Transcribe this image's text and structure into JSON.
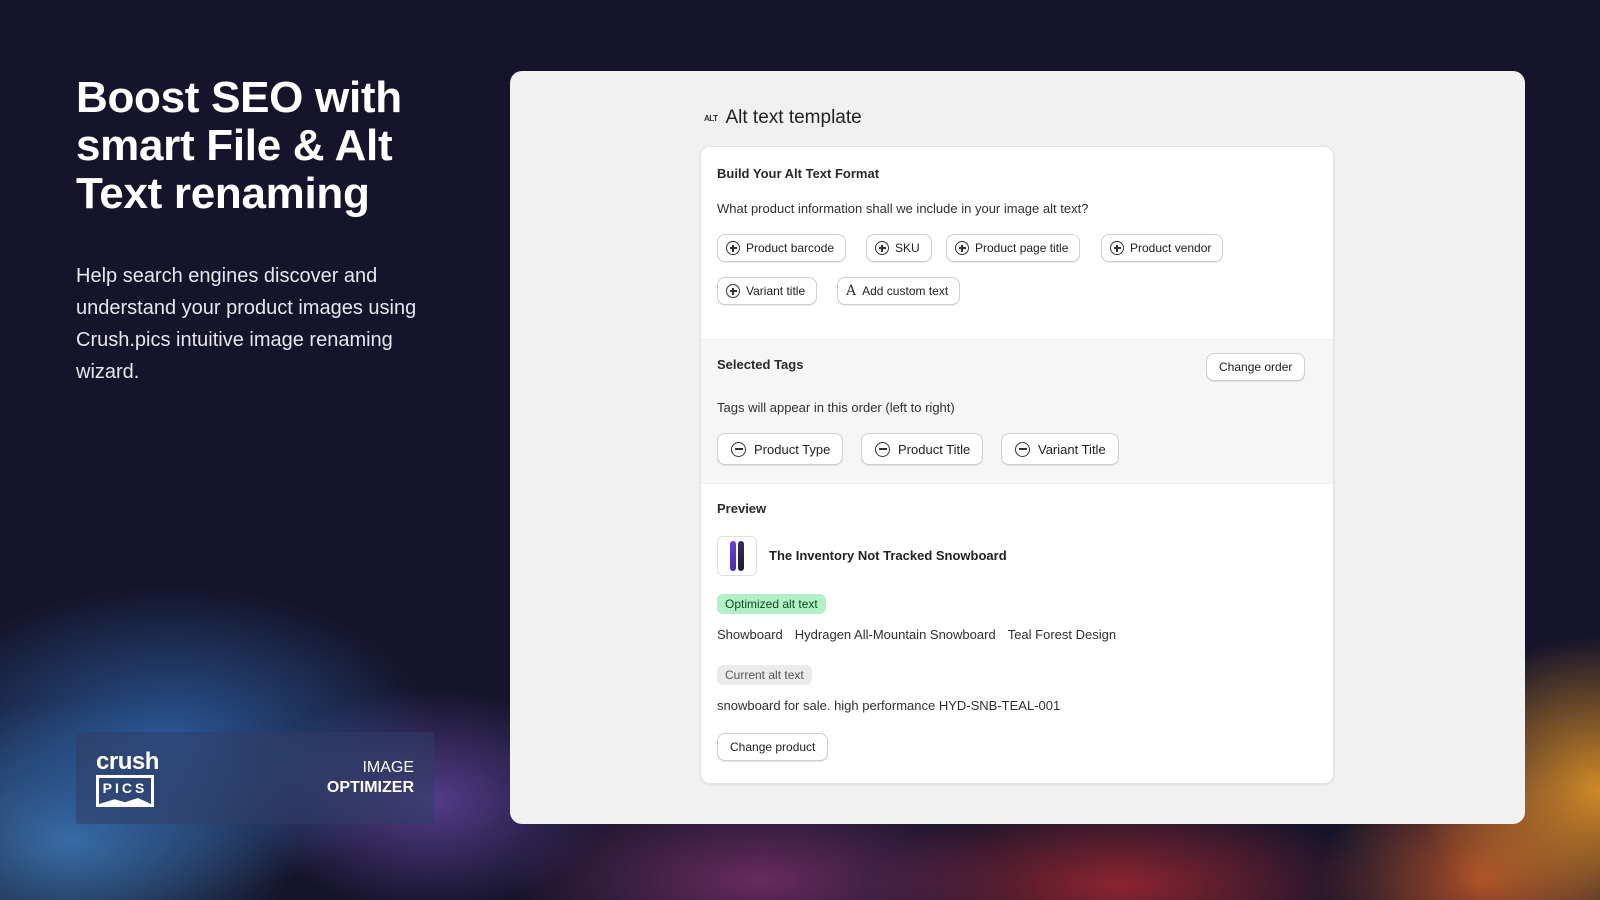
{
  "hero": {
    "title": "Boost SEO with smart File & Alt Text renaming",
    "description": "Help search engines discover and understand your product images using Crush.pics intuitive image renaming wizard."
  },
  "brand": {
    "logo_top": "crush",
    "logo_bottom": "PICS",
    "label_line1": "IMAGE",
    "label_line2": "OPTIMIZER"
  },
  "panel": {
    "icon_text": "ALT",
    "title": "Alt text template"
  },
  "format": {
    "heading": "Build Your Alt Text Format",
    "question": "What product information shall we include in your image alt text?",
    "options": [
      "Product barcode",
      "SKU",
      "Product page title",
      "Product vendor",
      "Variant title"
    ],
    "custom_label": "Add custom text"
  },
  "selected": {
    "heading": "Selected Tags",
    "change_order_label": "Change order",
    "note": "Tags will appear in this order (left to right)",
    "tags": [
      "Product Type",
      "Product Title",
      "Variant Title"
    ]
  },
  "preview": {
    "heading": "Preview",
    "product_name": "The Inventory Not Tracked Snowboard",
    "optimized_badge": "Optimized alt text",
    "optimized_parts": [
      "Showboard",
      "Hydragen All-Mountain Snowboard",
      "Teal Forest Design"
    ],
    "current_badge": "Current alt text",
    "current_text": "snowboard for sale. high performance HYD-SNB-TEAL-001",
    "change_product_label": "Change product"
  },
  "colors": {
    "background": "#15142a",
    "panel": "#f1f1f1",
    "optimized_badge": "#b4f0c6",
    "snowboard": "#6a3fd8"
  }
}
